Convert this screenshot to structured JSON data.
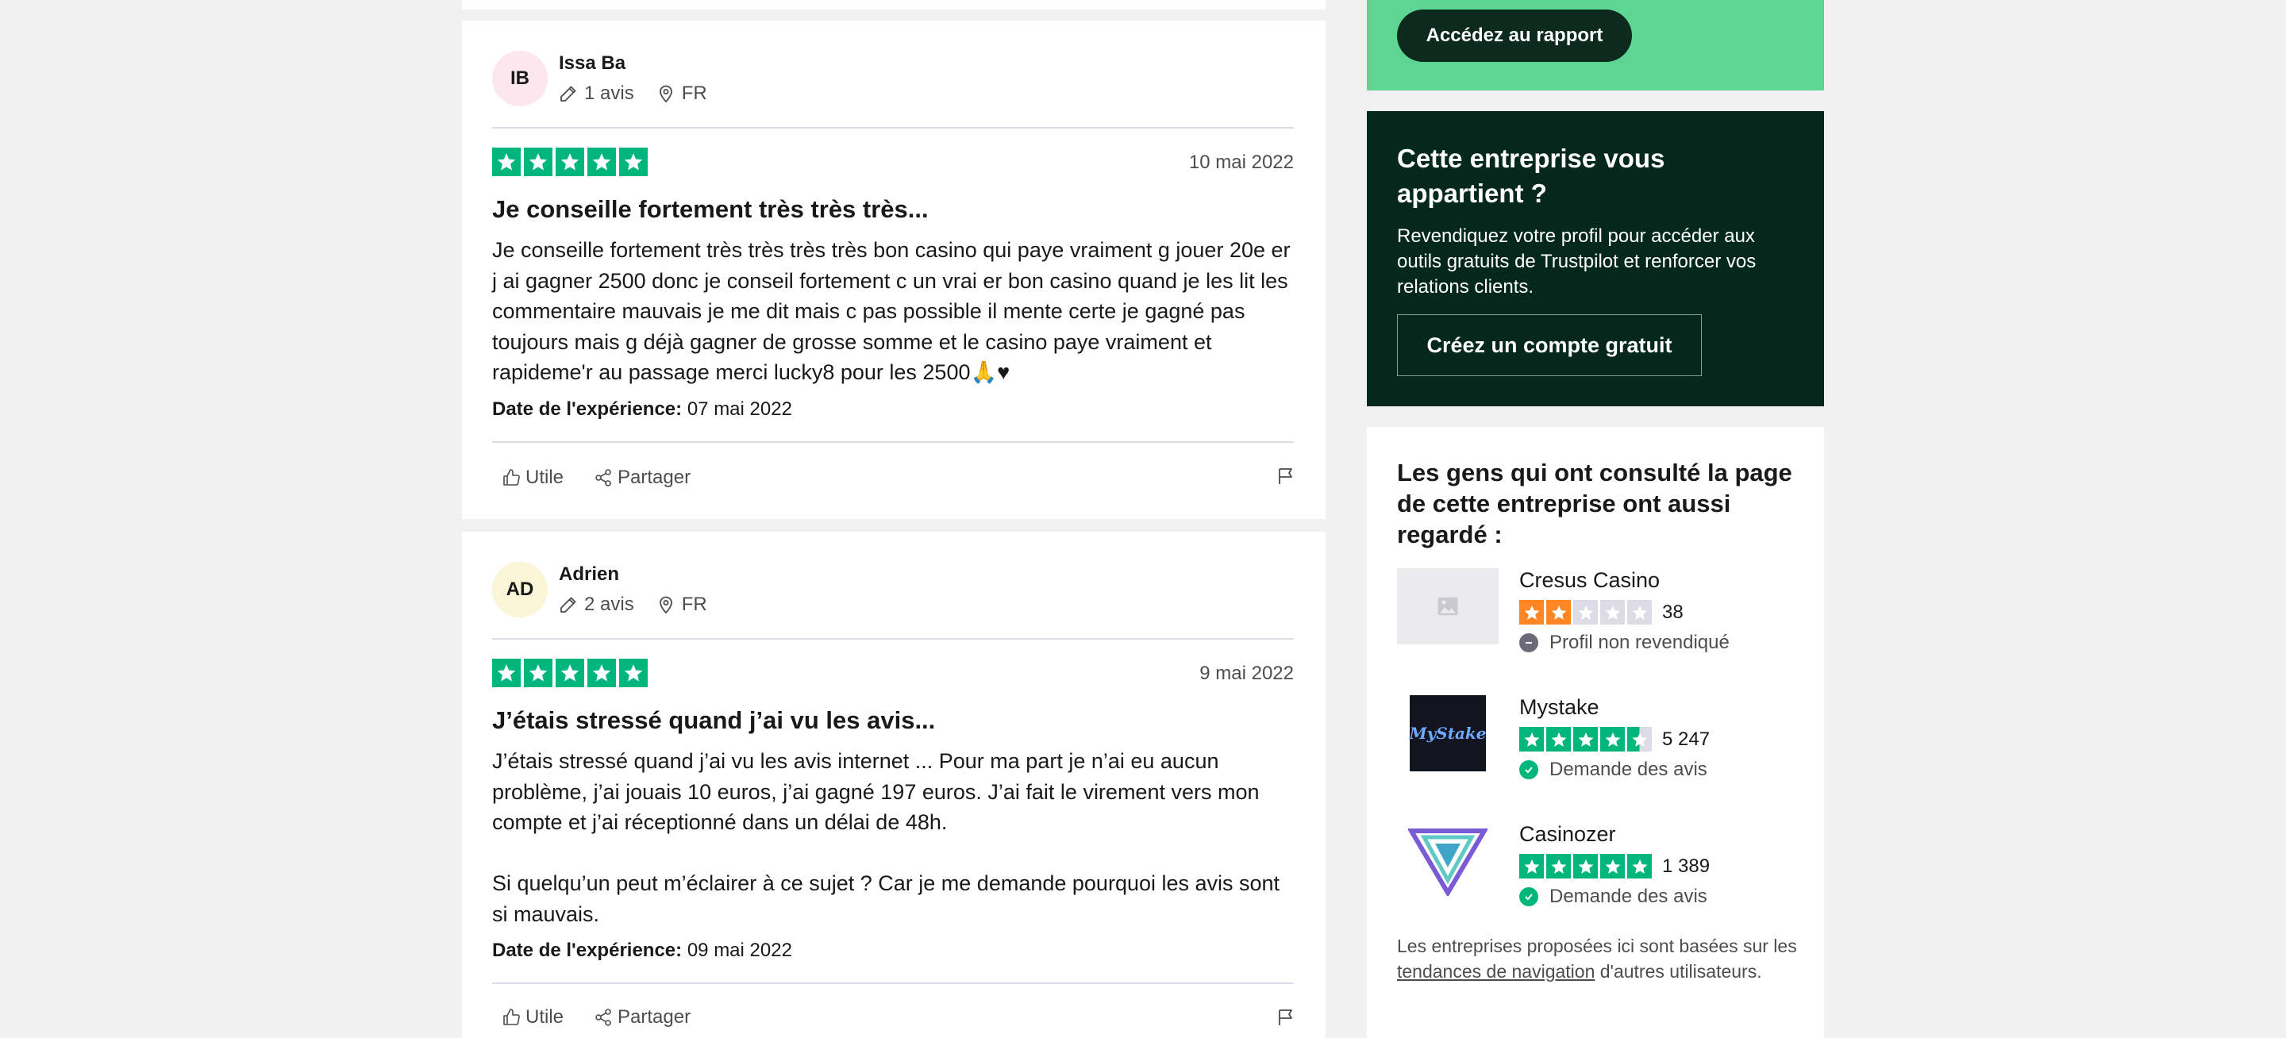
{
  "reviews": [
    {
      "initials": "IB",
      "avatar_color": "#fde7ee",
      "name": "Issa Ba",
      "review_count": "1 avis",
      "country": "FR",
      "date": "10 mai 2022",
      "title": "Je conseille fortement très très très...",
      "text": "Je conseille fortement très très très très bon casino qui paye vraiment g jouer 20e er j ai gagner 2500 donc je conseil fortement c un vrai er bon casino quand je les lit les commentaire mauvais je me dit mais c pas possible il mente certe je gagné pas toujours mais g déjà gagner de grosse somme et le casino paye vraiment et rapideme'r au passage merci lucky8 pour les 2500🙏♥",
      "exp_label": "Date de l'expérience:",
      "exp_date": "07 mai 2022",
      "useful": "Utile",
      "share": "Partager",
      "rating": 5
    },
    {
      "initials": "AD",
      "avatar_color": "#faf5d7",
      "name": "Adrien",
      "review_count": "2 avis",
      "country": "FR",
      "date": "9 mai 2022",
      "title": "J’étais stressé quand j’ai vu les avis...",
      "text_p1": "J’étais stressé quand j’ai vu les avis internet ... Pour ma part je n’ai eu aucun problème, j’ai jouais 10 euros, j’ai gagné 197 euros. J’ai fait le virement vers mon compte et j’ai réceptionné dans un délai de 48h.",
      "text_p2": "Si quelqu’un peut m’éclairer à ce sujet ? Car je me demande pourquoi les avis sont si mauvais.",
      "exp_label": "Date de l'expérience:",
      "exp_date": "09 mai 2022",
      "useful": "Utile",
      "share": "Partager",
      "rating": 5
    }
  ],
  "sidebar": {
    "report_button": "Accédez au rapport",
    "claim_title": "Cette entreprise vous appartient ?",
    "claim_text": "Revendiquez votre profil pour accéder aux outils gratuits de Trustpilot et renforcer vos relations clients.",
    "claim_button": "Créez un compte gratuit",
    "similar_title": "Les gens qui ont consulté la page de cette entreprise ont aussi regardé :",
    "companies": [
      {
        "name": "Cresus Casino",
        "count": "38",
        "status": "Profil non revendiqué",
        "rating": 2,
        "star_color": "#ff8622",
        "logo": "placeholder-image-icon"
      },
      {
        "name": "Mystake",
        "count": "5 247",
        "status": "Demande des avis",
        "rating": 4.5,
        "star_color": "#00b67a",
        "logo": "mystake-logo",
        "logo_text": "MyStake"
      },
      {
        "name": "Casinozer",
        "count": "1 389",
        "status": "Demande des avis",
        "rating": 5,
        "star_color": "#00b67a",
        "logo": "casinozer-logo"
      }
    ],
    "note_prefix": "Les entreprises proposées ici sont basées sur les",
    "note_link": "tendances de navigation",
    "note_suffix": "d'autres utilisateurs."
  },
  "colors": {
    "trustpilot_green": "#00b67a",
    "accent_green": "#5fd593",
    "dark_green": "#04291c"
  }
}
